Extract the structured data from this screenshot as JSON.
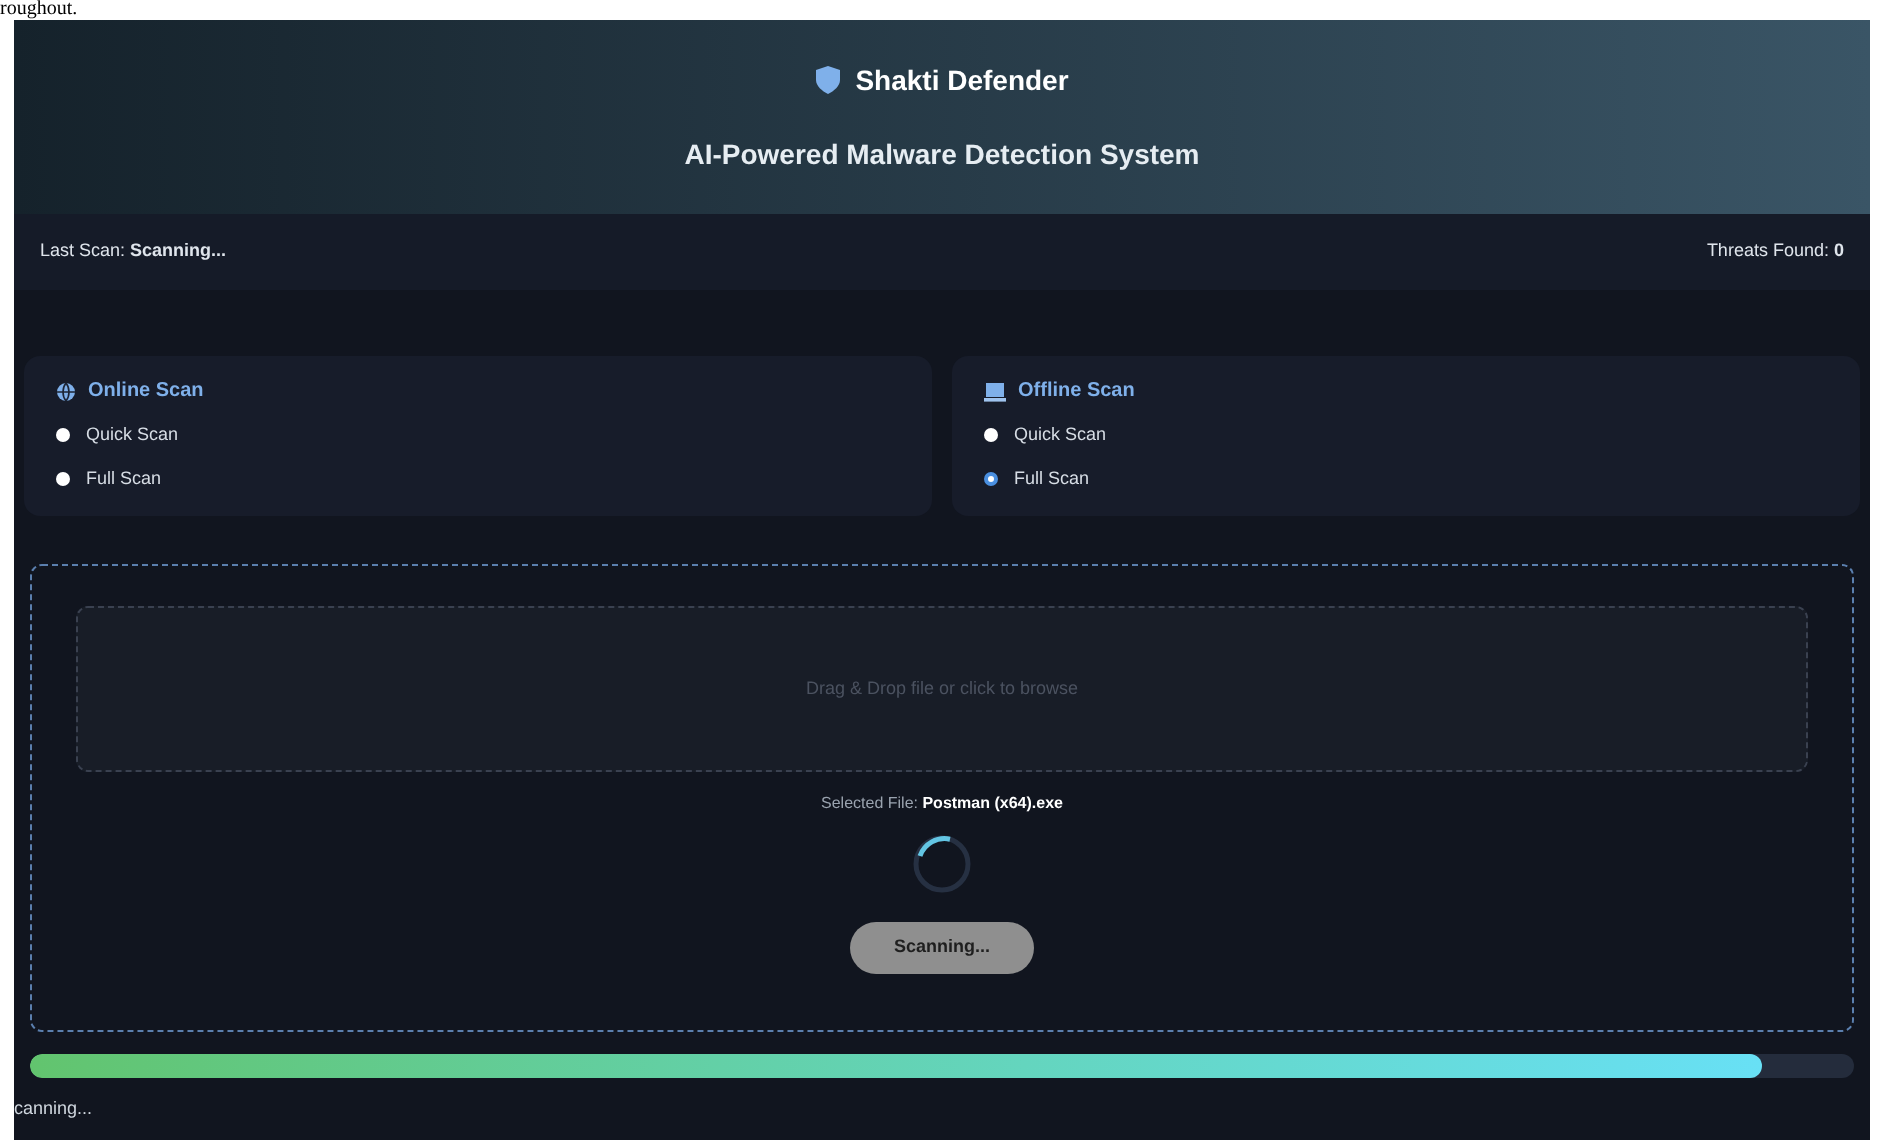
{
  "document_text": "roughout.",
  "header": {
    "title": "Shakti Defender",
    "subtitle": "AI-Powered Malware Detection System"
  },
  "info_bar": {
    "last_scan_label": "Last Scan:",
    "last_scan_value": "Scanning...",
    "threats_label": "Threats Found:",
    "threats_value": "0"
  },
  "scan_panels": [
    {
      "kind": "globe",
      "title": "Online Scan",
      "options": [
        {
          "label": "Quick Scan",
          "selected": false
        },
        {
          "label": "Full Scan",
          "selected": false
        }
      ]
    },
    {
      "kind": "laptop",
      "title": "Offline Scan",
      "options": [
        {
          "label": "Quick Scan",
          "selected": false
        },
        {
          "label": "Full Scan",
          "selected": true
        }
      ]
    }
  ],
  "upload": {
    "drop_text": "Drag & Drop file or click to browse",
    "selected_file_label": "Selected File:",
    "selected_file_name": "Postman (x64).exe",
    "button": "Scanning..."
  },
  "progress": {
    "level": 0.95
  },
  "status_bar": "canning..."
}
